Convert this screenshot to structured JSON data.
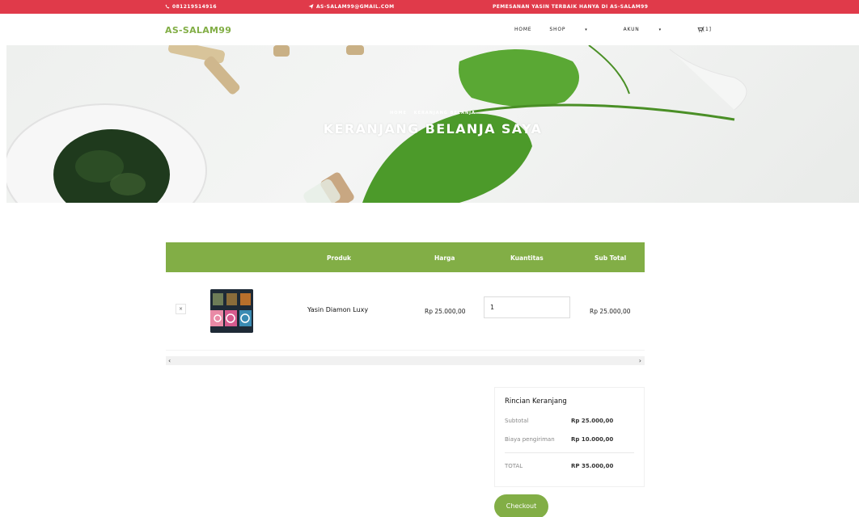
{
  "topbar": {
    "phone": "081219514916",
    "email": "AS-SALAM99@GMAIL.COM",
    "promo": "PEMESANAN YASIN TERBAIK HANYA DI AS-SALAM99"
  },
  "nav": {
    "brand": "AS-SALAM99",
    "items": [
      {
        "label": "HOME"
      },
      {
        "label": "SHOP"
      },
      {
        "label": "AKUN"
      }
    ],
    "cart_count": "[1]"
  },
  "hero": {
    "breadcrumb": [
      "HOME",
      "KERANJANG BELANJA"
    ],
    "title": "KERANJANG BELANJA SAYA"
  },
  "table": {
    "headers": [
      "Produk",
      "Harga",
      "Kuantitas",
      "Sub Total"
    ],
    "rows": [
      {
        "remove": "×",
        "name": "Yasin Diamon Luxy",
        "price": "Rp 25.000,00",
        "qty": "1",
        "subtotal": "Rp 25.000,00"
      }
    ]
  },
  "scroll": {
    "left": "‹",
    "right": "›"
  },
  "totals": {
    "title": "Rincian Keranjang",
    "subtotal_label": "Subtotal",
    "subtotal_value": "Rp 25.000,00",
    "shipping_label": "Biaya pengiriman",
    "shipping_value": "Rp 10.000,00",
    "total_label": "TOTAL",
    "total_value": "RP 35.000,00"
  },
  "checkout_label": "Checkout",
  "colors": {
    "accent": "#82ae46",
    "topbar": "#e03a4a"
  }
}
